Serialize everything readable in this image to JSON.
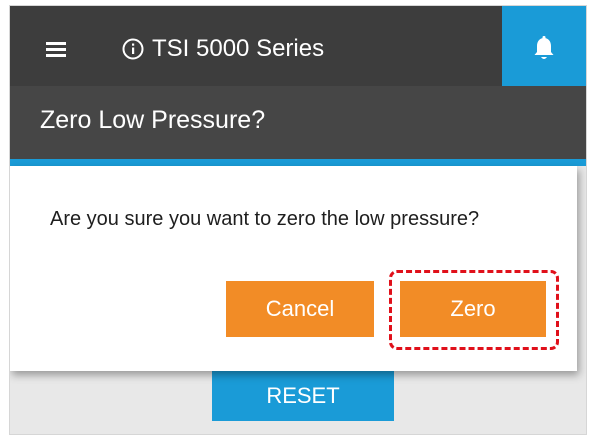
{
  "header": {
    "app_title": "TSI 5000 Series",
    "menu_icon": "hamburger-menu-icon",
    "info_icon": "info-icon",
    "notification_icon": "bell-icon"
  },
  "page": {
    "heading": "Zero Low Pressure?"
  },
  "dialog": {
    "message": "Are you sure you want to zero the low pressure?",
    "cancel_label": "Cancel",
    "confirm_label": "Zero"
  },
  "background": {
    "reset_label": "RESET"
  },
  "colors": {
    "header_bg": "#3d3d3d",
    "subheader_bg": "#464646",
    "accent_blue": "#1a9bd7",
    "button_orange": "#f28c26",
    "highlight_red": "#e0101a"
  }
}
